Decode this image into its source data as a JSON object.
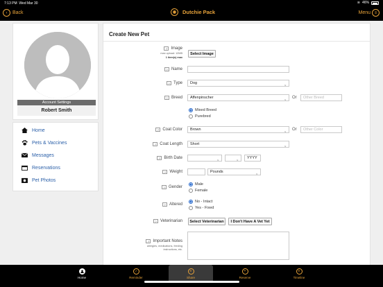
{
  "status": {
    "time": "7:13 PM",
    "date": "Wed Mar 30",
    "battery": "46%"
  },
  "navbar": {
    "back_label": "Back",
    "title": "Dutchie Pack",
    "menu_label": "Menu"
  },
  "profile": {
    "account_settings": "Account Settings",
    "name": "Robert Smith"
  },
  "nav": [
    {
      "label": "Home",
      "icon": "home-icon"
    },
    {
      "label": "Pets & Vaccines",
      "icon": "paw-icon"
    },
    {
      "label": "Messages",
      "icon": "message-icon"
    },
    {
      "label": "Reservations",
      "icon": "calendar-icon"
    },
    {
      "label": "Pet Photos",
      "icon": "photo-icon"
    }
  ],
  "form": {
    "title": "Create New Pet",
    "image": {
      "label": "Image",
      "sub1": "max upload: 12MB",
      "sub2": "1 item(s) max",
      "button": "Select Image"
    },
    "name": {
      "label": "Name",
      "value": ""
    },
    "type": {
      "label": "Type",
      "value": "Dog"
    },
    "breed": {
      "label": "Breed",
      "value": "Affenpinscher",
      "or": "Or",
      "other_placeholder": "Other Breed",
      "options": [
        "Mixed Breed",
        "Purebred"
      ],
      "selected": "Mixed Breed"
    },
    "coat_color": {
      "label": "Coat Color",
      "value": "Brown",
      "or": "Or",
      "other_placeholder": "Other Color"
    },
    "coat_length": {
      "label": "Coat Length",
      "value": "Short"
    },
    "birth_date": {
      "label": "Birth Date",
      "year_placeholder": "YYYY"
    },
    "weight": {
      "label": "Weight",
      "unit": "Pounds"
    },
    "gender": {
      "label": "Gender",
      "options": [
        "Male",
        "Female"
      ],
      "selected": "Male"
    },
    "altered": {
      "label": "Altered",
      "options": [
        "No - Intact",
        "Yes - Fixed"
      ],
      "selected": "No - Intact"
    },
    "veterinarian": {
      "label": "Veterinarian",
      "select_button": "Select Veterinarian",
      "no_vet_button": "I Don't Have A Vet Yet"
    },
    "notes": {
      "label": "Important Notes",
      "sub": "allergies, medications, feeding instructions, etc."
    },
    "help_glyph": "?"
  },
  "tabs": [
    {
      "label": "Home",
      "icon": "home-icon"
    },
    {
      "label": "Reminder",
      "icon": "bell-icon"
    },
    {
      "label": "Share",
      "icon": "share-icon"
    },
    {
      "label": "Reserve",
      "icon": "plus-icon"
    },
    {
      "label": "Timeline",
      "icon": "timeline-icon"
    }
  ],
  "colors": {
    "accent": "#e8a33a",
    "link": "#2a5fa8",
    "radio": "#2266cc"
  }
}
